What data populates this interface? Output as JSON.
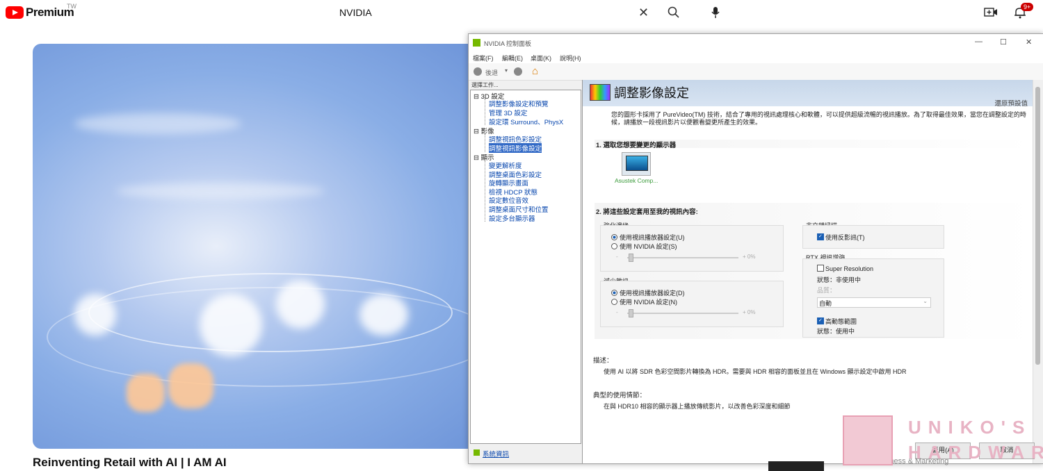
{
  "youtube": {
    "brand": "Premium",
    "region": "TW",
    "search_value": "NVIDIA",
    "notification_count": "9+",
    "video_title": "Reinventing Retail with AI | I AM AI"
  },
  "window": {
    "title": "NVIDIA 控制面板",
    "menu": [
      "檔案(F)",
      "編輯(E)",
      "桌面(K)",
      "說明(H)"
    ],
    "toolbar": {
      "back": "後退"
    },
    "task_label": "選擇工作...",
    "tree": {
      "groups": [
        {
          "label": "3D 設定",
          "items": [
            "調整影像設定和預覽",
            "管理 3D 設定",
            "設定環 Surround、PhysX"
          ]
        },
        {
          "label": "影像",
          "items": [
            "調整視訊色彩設定",
            "調整視訊影像設定"
          ]
        },
        {
          "label": "顯示",
          "items": [
            "變更解析度",
            "調整桌面色彩設定",
            "旋轉顯示畫面",
            "檢視 HDCP 狀態",
            "設定數位音效",
            "調整桌面尺寸和位置",
            "設定多台顯示器"
          ]
        }
      ]
    },
    "system_info": "系統資訊",
    "panel": {
      "title": "調整影像設定",
      "restore": "還原預設值",
      "intro": "您的圖形卡採用了 PureVideo(TM) 技術，結合了專用的視訊處理核心和軟體，可以提供超級流暢的視訊播放。為了取得最佳效果，當您在調整設定的時候，請播放一段視訊影片以便觀看變更所產生的效果。",
      "section1": "1. 選取您想要變更的顯示器",
      "monitor_label": "Asustek Comp...",
      "section2": "2. 將這些設定套用至我的視訊內容:",
      "edge": {
        "label": "強化邊緣",
        "opt1": "使用視訊播放器設定(U)",
        "opt2": "使用 NVIDIA 設定(S)",
        "minus": "-",
        "plus": "+ 0%"
      },
      "noise": {
        "label": "減少雜訊",
        "opt1": "使用視訊播放器設定(D)",
        "opt2": "使用 NVIDIA 設定(N)",
        "minus": "-",
        "plus": "+ 0%"
      },
      "deinterlace": {
        "label": "非交錯掃描",
        "opt": "使用反影訊(T)"
      },
      "rtx": {
        "label": "RTX 視訊增強",
        "super_res": "Super Resolution",
        "status1": "狀態：非使用中",
        "quality_label": "品質：",
        "quality_value": "自動",
        "hdr": "高動態範圍",
        "status2": "狀態：使用中"
      },
      "desc_label": "描述：",
      "desc_text": "使用 AI 以將 SDR 色彩空間影片轉換為 HDR。需要與 HDR 相容的面板並且在 Windows 顯示設定中啟用 HDR",
      "usage_label": "典型的使用情節：",
      "usage_text": "在與 HDR10 相容的顯示器上播放傳統影片，以改善色彩深度和細節"
    },
    "apply": "套用(A)",
    "cancel": "取消"
  },
  "watermark": {
    "line1": "UNIKO'S",
    "line2": "HARDWARE"
  },
  "bottom_caption": "Business & Marketing",
  "colors": {
    "youtube_red": "#ff0000",
    "nvidia_green": "#76b900",
    "selection_blue": "#3169c6"
  }
}
